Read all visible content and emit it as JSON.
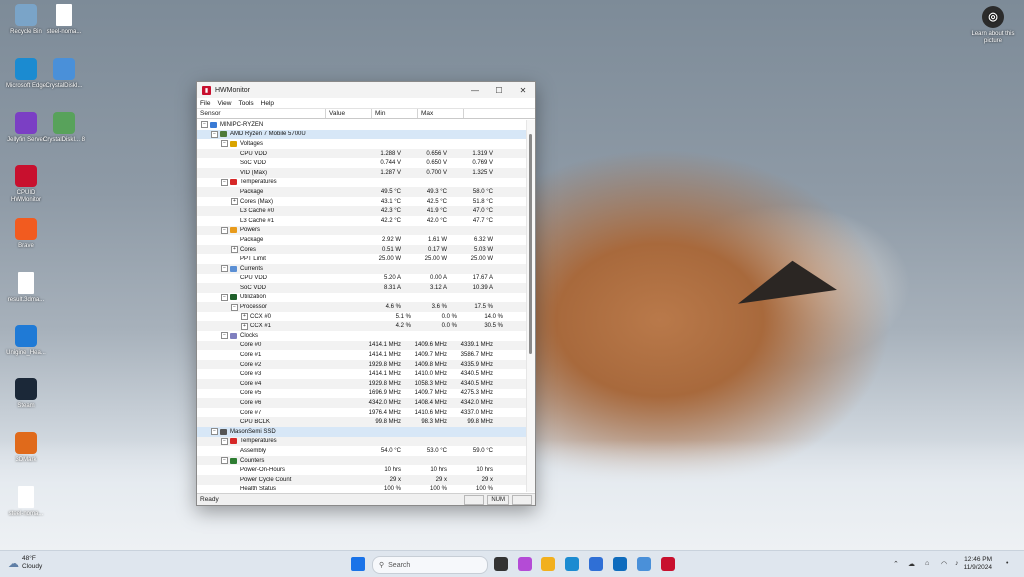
{
  "desktop": {
    "icons": [
      {
        "label": "Recycle Bin",
        "glyph": "recycle-bin-icon",
        "color": "#7aa4c8"
      },
      {
        "label": "steel-noma...",
        "glyph": "file-icon",
        "color": "#ffffff"
      },
      {
        "label": "Microsoft Edge",
        "glyph": "edge-icon",
        "color": "#1b8bd1"
      },
      {
        "label": "CrystalDiskI...",
        "glyph": "crystaldiskinfo-icon",
        "color": "#4a90d9"
      },
      {
        "label": "Jellyfin Server",
        "glyph": "jellyfin-icon",
        "color": "#7b3fc4"
      },
      {
        "label": "CrystalDiskI... 8",
        "glyph": "crystaldiskinfo8-icon",
        "color": "#58a25b"
      },
      {
        "label": "CPUID HWMonitor",
        "glyph": "hwmonitor-icon",
        "color": "#c8102e"
      },
      {
        "label": "Brave",
        "glyph": "brave-icon",
        "color": "#f25b1f"
      },
      {
        "label": "result.3dma...",
        "glyph": "file-icon",
        "color": "#ffffff"
      },
      {
        "label": "Unigine_Hea...",
        "glyph": "unigine-icon",
        "color": "#1f7ad6"
      },
      {
        "label": "Steam",
        "glyph": "steam-icon",
        "color": "#1b2838"
      },
      {
        "label": "3DMark",
        "glyph": "3dmark-icon",
        "color": "#e06a1b"
      },
      {
        "label": "steel-noma...",
        "glyph": "file-icon",
        "color": "#ffffff"
      }
    ],
    "learn_about": {
      "label": "Learn about this picture"
    }
  },
  "window": {
    "title": "HWMonitor",
    "menu": [
      "File",
      "View",
      "Tools",
      "Help"
    ],
    "columns": [
      "Sensor",
      "Value",
      "Min",
      "Max"
    ],
    "rows": [
      {
        "indent": 0,
        "exp": "−",
        "icon": "computer-icon",
        "ic": "#3a7bd5",
        "name": "MINIPC-RYZEN",
        "v": "",
        "min": "",
        "max": ""
      },
      {
        "indent": 1,
        "exp": "−",
        "icon": "cpu-chip-icon",
        "ic": "#4d7b3a",
        "name": "AMD Ryzen 7 Mobile 5700U",
        "v": "",
        "min": "",
        "max": "",
        "sel": true
      },
      {
        "indent": 2,
        "exp": "−",
        "icon": "voltage-icon",
        "ic": "#d9a400",
        "name": "Voltages",
        "v": "",
        "min": "",
        "max": ""
      },
      {
        "indent": 3,
        "name": "CPU VDD",
        "v": "1.288 V",
        "min": "0.656 V",
        "max": "1.319 V"
      },
      {
        "indent": 3,
        "name": "SoC VDD",
        "v": "0.744 V",
        "min": "0.650 V",
        "max": "0.769 V"
      },
      {
        "indent": 3,
        "name": "VID (Max)",
        "v": "1.287 V",
        "min": "0.700 V",
        "max": "1.325 V"
      },
      {
        "indent": 2,
        "exp": "−",
        "icon": "thermometer-icon",
        "ic": "#d62828",
        "name": "Temperatures",
        "v": "",
        "min": "",
        "max": ""
      },
      {
        "indent": 3,
        "name": "Package",
        "v": "49.5 °C",
        "min": "49.3 °C",
        "max": "58.0 °C"
      },
      {
        "indent": 3,
        "exp": "+",
        "name": "Cores (Max)",
        "v": "43.1 °C",
        "min": "42.5 °C",
        "max": "51.8 °C"
      },
      {
        "indent": 3,
        "name": "L3 Cache #0",
        "v": "42.3 °C",
        "min": "41.9 °C",
        "max": "47.0 °C"
      },
      {
        "indent": 3,
        "name": "L3 Cache #1",
        "v": "42.2 °C",
        "min": "42.0 °C",
        "max": "47.7 °C"
      },
      {
        "indent": 2,
        "exp": "−",
        "icon": "power-icon",
        "ic": "#e89b1c",
        "name": "Powers",
        "v": "",
        "min": "",
        "max": ""
      },
      {
        "indent": 3,
        "name": "Package",
        "v": "2.92 W",
        "min": "1.61 W",
        "max": "6.32 W"
      },
      {
        "indent": 3,
        "exp": "+",
        "name": "Cores",
        "v": "0.51 W",
        "min": "0.17 W",
        "max": "5.03 W"
      },
      {
        "indent": 3,
        "name": "PPT Limit",
        "v": "25.00 W",
        "min": "25.00 W",
        "max": "25.00 W"
      },
      {
        "indent": 2,
        "exp": "−",
        "icon": "current-icon",
        "ic": "#5b8fd4",
        "name": "Currents",
        "v": "",
        "min": "",
        "max": ""
      },
      {
        "indent": 3,
        "name": "CPU VDD",
        "v": "5.20 A",
        "min": "0.00 A",
        "max": "17.67 A"
      },
      {
        "indent": 3,
        "name": "SoC VDD",
        "v": "8.31 A",
        "min": "3.12 A",
        "max": "10.39 A"
      },
      {
        "indent": 2,
        "exp": "−",
        "icon": "utilization-icon",
        "ic": "#1f5f2a",
        "name": "Utilization",
        "v": "",
        "min": "",
        "max": ""
      },
      {
        "indent": 3,
        "exp": "−",
        "name": "Processor",
        "v": "4.6 %",
        "min": "3.6 %",
        "max": "17.5 %"
      },
      {
        "indent": 4,
        "exp": "+",
        "name": "CCX #0",
        "v": "5.1 %",
        "min": "0.0 %",
        "max": "14.0 %"
      },
      {
        "indent": 4,
        "exp": "+",
        "name": "CCX #1",
        "v": "4.2 %",
        "min": "0.0 %",
        "max": "30.5 %"
      },
      {
        "indent": 2,
        "exp": "−",
        "icon": "clock-icon",
        "ic": "#7f7fbf",
        "name": "Clocks",
        "v": "",
        "min": "",
        "max": ""
      },
      {
        "indent": 3,
        "name": "Core #0",
        "v": "1414.1 MHz",
        "min": "1409.6 MHz",
        "max": "4339.1 MHz"
      },
      {
        "indent": 3,
        "name": "Core #1",
        "v": "1414.1 MHz",
        "min": "1409.7 MHz",
        "max": "3586.7 MHz"
      },
      {
        "indent": 3,
        "name": "Core #2",
        "v": "1929.8 MHz",
        "min": "1409.8 MHz",
        "max": "4335.9 MHz"
      },
      {
        "indent": 3,
        "name": "Core #3",
        "v": "1414.1 MHz",
        "min": "1410.0 MHz",
        "max": "4340.5 MHz"
      },
      {
        "indent": 3,
        "name": "Core #4",
        "v": "1929.8 MHz",
        "min": "1058.3 MHz",
        "max": "4340.5 MHz"
      },
      {
        "indent": 3,
        "name": "Core #5",
        "v": "1696.9 MHz",
        "min": "1409.7 MHz",
        "max": "4275.3 MHz"
      },
      {
        "indent": 3,
        "name": "Core #6",
        "v": "4342.0 MHz",
        "min": "1408.4 MHz",
        "max": "4342.0 MHz"
      },
      {
        "indent": 3,
        "name": "Core #7",
        "v": "1976.4 MHz",
        "min": "1410.6 MHz",
        "max": "4337.0 MHz"
      },
      {
        "indent": 3,
        "name": "CPU BCLK",
        "v": "99.8 MHz",
        "min": "98.3 MHz",
        "max": "99.8 MHz"
      },
      {
        "indent": 1,
        "exp": "−",
        "icon": "ssd-icon",
        "ic": "#555555",
        "name": "MasonSemi SSD",
        "v": "",
        "min": "",
        "max": "",
        "sel": true
      },
      {
        "indent": 2,
        "exp": "−",
        "icon": "thermometer-icon",
        "ic": "#d62828",
        "name": "Temperatures",
        "v": "",
        "min": "",
        "max": ""
      },
      {
        "indent": 3,
        "name": "Assembly",
        "v": "54.0 °C",
        "min": "53.0 °C",
        "max": "59.0 °C"
      },
      {
        "indent": 2,
        "exp": "−",
        "icon": "counter-icon",
        "ic": "#2e7d32",
        "name": "Counters",
        "v": "",
        "min": "",
        "max": ""
      },
      {
        "indent": 3,
        "name": "Power-On-Hours",
        "v": "10 hrs",
        "min": "10 hrs",
        "max": "10 hrs"
      },
      {
        "indent": 3,
        "name": "Power Cycle Count",
        "v": "29 x",
        "min": "29 x",
        "max": "29 x"
      },
      {
        "indent": 3,
        "name": "Health Status",
        "v": "100 %",
        "min": "100 %",
        "max": "100 %"
      }
    ],
    "status": {
      "ready": "Ready",
      "num": "NUM"
    }
  },
  "taskbar": {
    "weather": {
      "temp": "48°F",
      "cond": "Cloudy"
    },
    "search_placeholder": "Search",
    "pinned": [
      {
        "name": "start-icon",
        "color": "#1a73e8"
      },
      {
        "name": "task-view-icon",
        "color": "#333333"
      },
      {
        "name": "copilot-icon",
        "color": "#b44bd6"
      },
      {
        "name": "file-explorer-icon",
        "color": "#f2b01e"
      },
      {
        "name": "edge-icon",
        "color": "#1b8bd1"
      },
      {
        "name": "store-icon",
        "color": "#2f6fd6"
      },
      {
        "name": "outlook-icon",
        "color": "#0f6cbd"
      },
      {
        "name": "crystaldiskinfo-icon",
        "color": "#4a90d9"
      },
      {
        "name": "hwmonitor-icon",
        "color": "#c8102e"
      }
    ],
    "time": "12:46 PM",
    "date": "11/9/2024"
  }
}
